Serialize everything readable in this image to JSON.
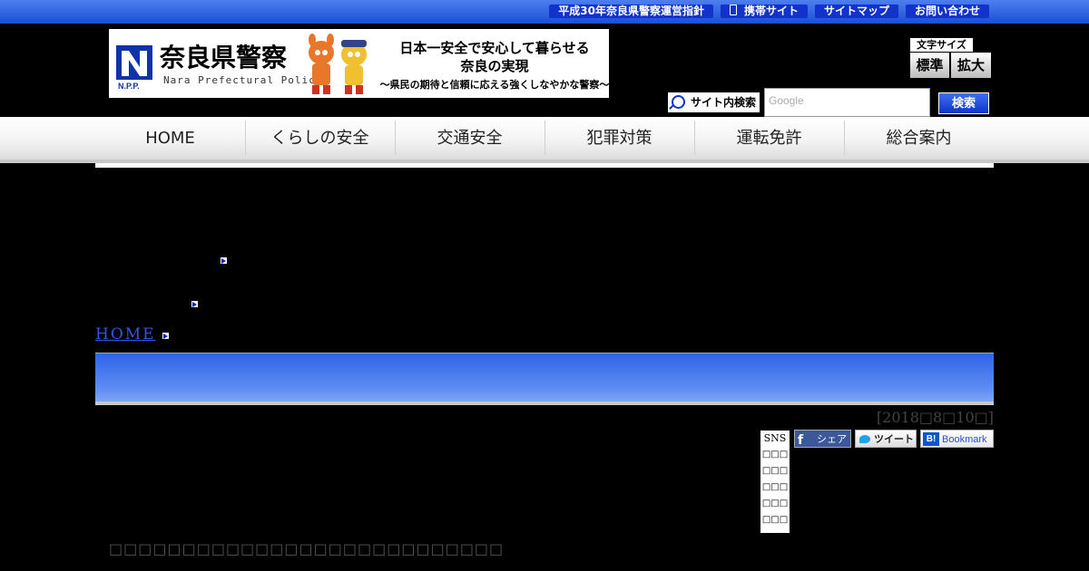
{
  "colors": {
    "accent": "#1133cc",
    "background": "#000000",
    "title_bar": "#3a6ee8"
  },
  "top_links": [
    {
      "label": "平成30年奈良県警察運営指針"
    },
    {
      "label": "携帯サイト",
      "icon": "phone-icon"
    },
    {
      "label": "サイトマップ"
    },
    {
      "label": "お問い合わせ"
    }
  ],
  "header": {
    "org_name": "奈良県警察",
    "org_en": "Nara Prefectural Police",
    "npp": "N.P.P.",
    "slogan_line1": "日本一安全で安心して暮らせる",
    "slogan_line2": "奈良の実現",
    "slogan_line3": "〜県民の期待と信頼に応える強くしなやかな警察〜"
  },
  "font_size": {
    "label": "文字サイズ",
    "standard": "標準",
    "large": "拡大"
  },
  "search": {
    "label": "サイト内検索",
    "placeholder": "Google",
    "button": "検索"
  },
  "nav": [
    {
      "label": "HOME"
    },
    {
      "label": "くらしの安全"
    },
    {
      "label": "交通安全"
    },
    {
      "label": "犯罪対策"
    },
    {
      "label": "運転免許"
    },
    {
      "label": "総合案内"
    }
  ],
  "breadcrumb": {
    "home": "HOME"
  },
  "date": "[2018□8□10□]",
  "sns": {
    "header": "SNS",
    "lines": [
      "□□□",
      "□□□",
      "□□□",
      "□□□",
      "□□□"
    ],
    "facebook": "シェア",
    "twitter": "ツイート",
    "hatena": "Bookmark",
    "hatena_icon_text": "B!"
  },
  "body_text": "□□□□□□□□□□□□□□□□□□□□□□□□□□□"
}
